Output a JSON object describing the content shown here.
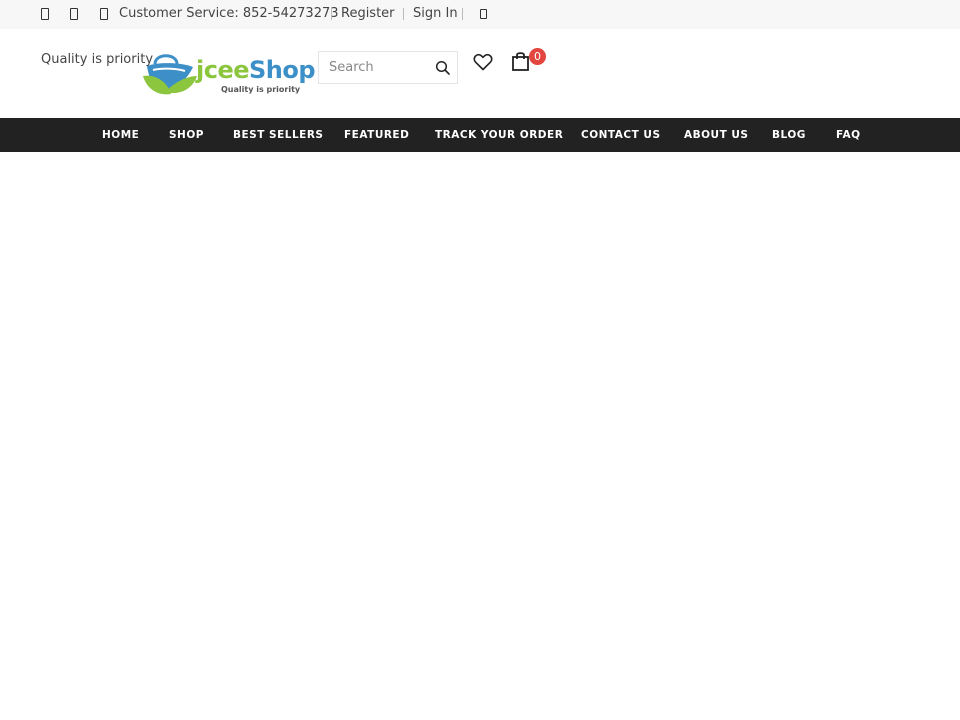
{
  "topbar": {
    "customer_service": "Customer Service: 852-54273273",
    "register": "Register",
    "sign_in": "Sign In",
    "icons": [
      "facebook-icon",
      "twitter-icon",
      "instagram-icon",
      "language-icon"
    ]
  },
  "header": {
    "tagline": "Quality is priority",
    "logo": {
      "word_part1": "jcee",
      "word_part2": "Shop",
      "subtitle": "Quality is priority"
    },
    "search": {
      "placeholder": "Search",
      "value": ""
    },
    "cart_count": "0"
  },
  "nav": {
    "items": [
      {
        "label": "HOME"
      },
      {
        "label": "SHOP"
      },
      {
        "label": "BEST SELLERS"
      },
      {
        "label": "FEATURED"
      },
      {
        "label": "TRACK YOUR ORDER"
      },
      {
        "label": "CONTACT US"
      },
      {
        "label": "ABOUT US"
      },
      {
        "label": "BLOG"
      },
      {
        "label": "FAQ"
      }
    ]
  },
  "colors": {
    "nav_bg": "#222222",
    "topbar_bg": "#f7f7f7",
    "badge": "#e2463f",
    "logo_green": "#8cc63f",
    "logo_blue": "#3d8fc8"
  }
}
